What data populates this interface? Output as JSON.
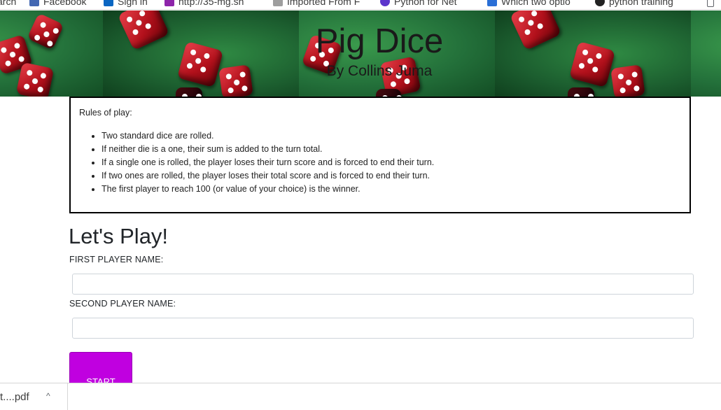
{
  "bookmarks": [
    {
      "label": "arch",
      "color": ""
    },
    {
      "label": "Facebook",
      "color": "#4267b2"
    },
    {
      "label": "Sign in",
      "color": "#0a66c2"
    },
    {
      "label": "http://35-mg.sh",
      "color": "#8e24aa"
    },
    {
      "label": "Imported From F",
      "color": "#9e9e9e"
    },
    {
      "label": "Python for Net",
      "color": "#5c35cc"
    },
    {
      "label": "Which two optio",
      "color": "#2a6fd6"
    },
    {
      "label": "python training",
      "color": "#222222"
    }
  ],
  "banner": {
    "title": "Pig Dice",
    "subtitle": "By Collins Juma"
  },
  "rules": {
    "heading": "Rules of play:",
    "items": [
      "Two standard dice are rolled.",
      "If neither die is a one, their sum is added to the turn total.",
      "If a single one is rolled, the player loses their turn score and is forced to end their turn.",
      "If two ones are rolled, the player loses their total score and is forced to end their turn.",
      "The first player to reach 100 (or value of your choice) is the winner."
    ]
  },
  "play": {
    "title": "Let's Play!",
    "first_label": "FIRST PLAYER NAME:",
    "first_value": "",
    "second_label": "SECOND PLAYER NAME:",
    "second_value": "",
    "start_label": "START"
  },
  "downloads": {
    "file_name": "t....pdf",
    "chevron": "^"
  },
  "colors": {
    "start_button": "#c000e0",
    "rules_border": "#000000"
  }
}
